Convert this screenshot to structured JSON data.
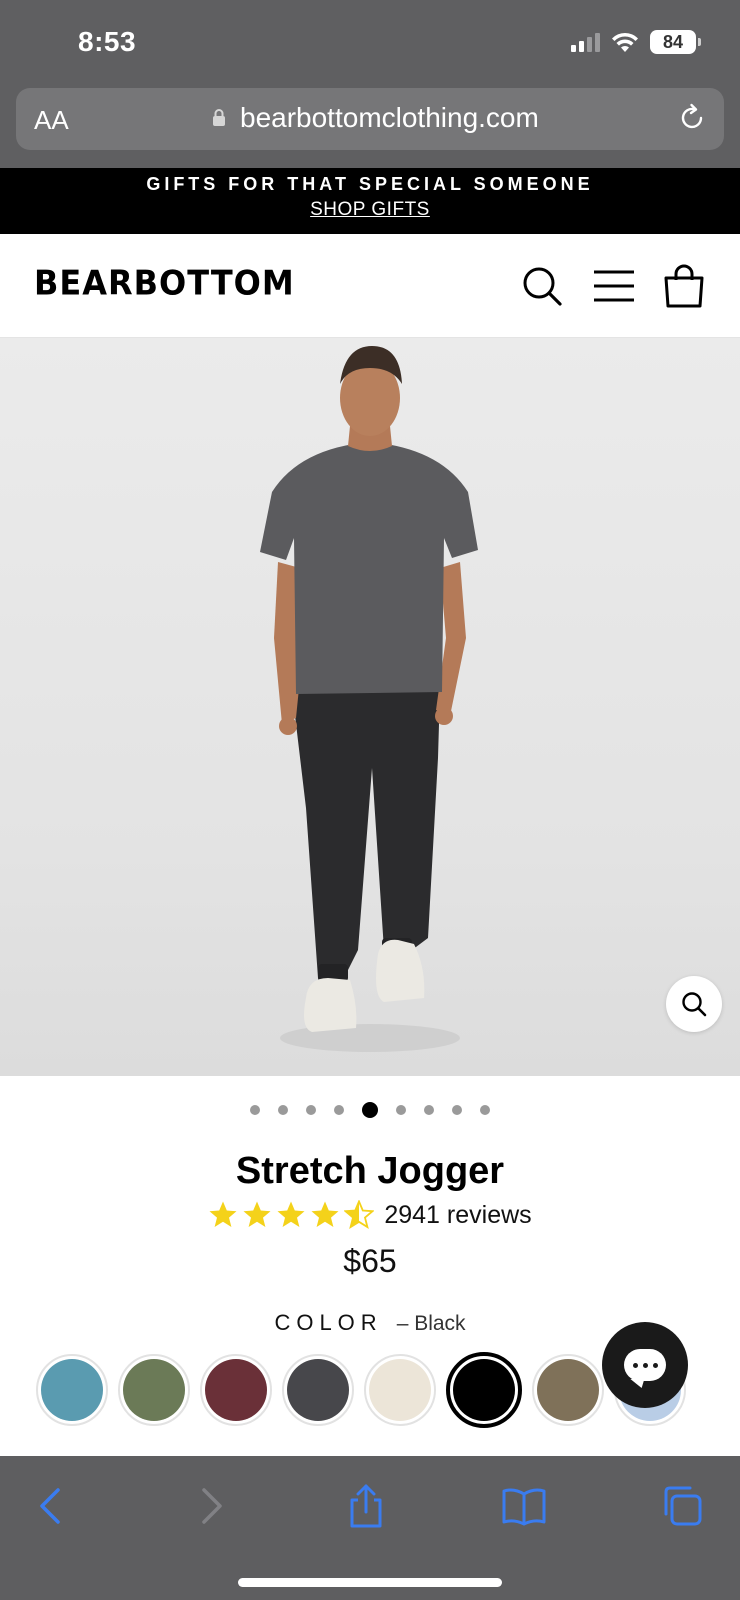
{
  "status_bar": {
    "time": "8:53",
    "battery": "84",
    "icons": [
      "cellular-signal-icon",
      "wifi-icon",
      "battery-icon"
    ]
  },
  "browser": {
    "text_size_button": "AA",
    "url": "bearbottomclothing.com",
    "icons": [
      "lock-icon",
      "reload-icon"
    ]
  },
  "promo_banner": {
    "title": "GIFTS FOR THAT SPECIAL SOMEONE",
    "link": "SHOP GIFTS"
  },
  "header": {
    "logo": "BEARBOTTOM",
    "icons": [
      "search-icon",
      "menu-icon",
      "shopping-bag-icon"
    ]
  },
  "gallery": {
    "image_count": 9,
    "active_index": 5,
    "icons": [
      "zoom-icon"
    ]
  },
  "product": {
    "title": "Stretch Jogger",
    "rating": 4.5,
    "reviews": "2941 reviews",
    "price": "$65"
  },
  "color_selector": {
    "label": "COLOR",
    "selected": "– Black",
    "swatches": [
      {
        "color": "#5a9bb0"
      },
      {
        "color": "#6b7a57"
      },
      {
        "color": "#6a3038"
      },
      {
        "color": "#47474b"
      },
      {
        "color": "#ece5d8"
      },
      {
        "color": "#000000",
        "selected": true
      },
      {
        "color": "#7f7159"
      },
      {
        "color": "#b9cde6"
      }
    ]
  },
  "chat": {
    "icons": [
      "chat-icon"
    ]
  },
  "toolbar": {
    "icons": [
      "back-icon",
      "forward-icon",
      "share-icon",
      "bookmarks-icon",
      "tabs-icon"
    ]
  },
  "colors": {
    "accent_blue": "#3a7cf0",
    "star_yellow": "#f4d21a",
    "chrome_gray": "#5f5f61"
  }
}
